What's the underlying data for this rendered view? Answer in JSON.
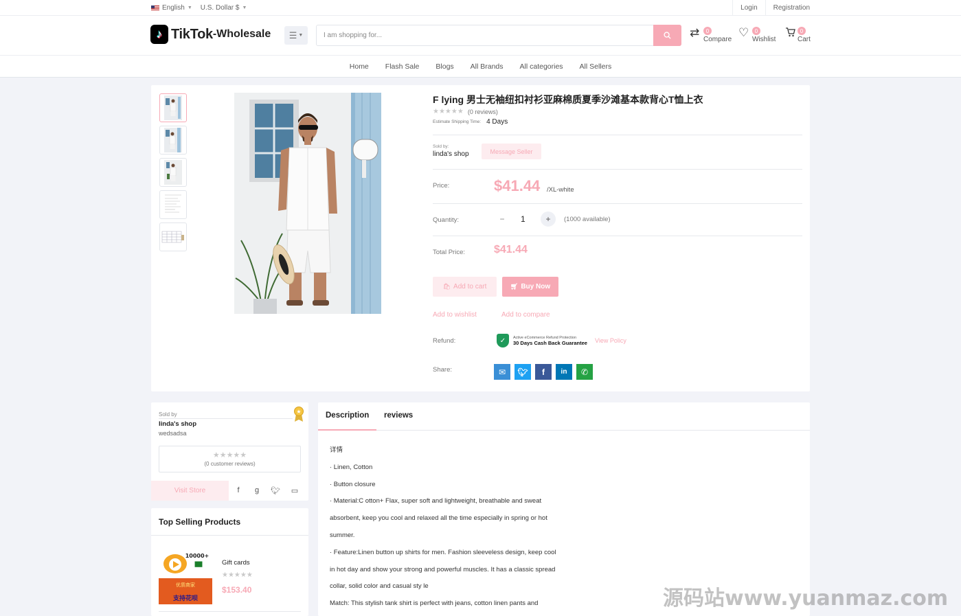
{
  "topbar": {
    "language": "English",
    "currency": "U.S. Dollar $",
    "login": "Login",
    "registration": "Registration"
  },
  "header": {
    "logo_main": "TikTok",
    "logo_sub": "-Wholesale",
    "search_placeholder": "I am shopping for...",
    "compare": {
      "label": "Compare",
      "count": "0"
    },
    "wishlist": {
      "label": "Wishlist",
      "count": "0"
    },
    "cart": {
      "label": "Cart",
      "count": "0"
    }
  },
  "nav": [
    "Home",
    "Flash Sale",
    "Blogs",
    "All Brands",
    "All categories",
    "All Sellers"
  ],
  "product": {
    "title": "F lying 男士无袖纽扣衬衫亚麻棉质夏季沙滩基本款背心T恤上衣",
    "stars": "★★★★★",
    "reviews": "(0 reviews)",
    "ship_label": "Estimate Shipping Time:",
    "ship_value": "4 Days",
    "sold_by_label": "Sold by:",
    "shop_name": "linda's shop",
    "message_seller": "Message Seller",
    "price_label": "Price:",
    "price": "$41.44",
    "variant": "/XL-white",
    "quantity_label": "Quantity:",
    "quantity": "1",
    "available": "(1000 available)",
    "total_label": "Total Price:",
    "total": "$41.44",
    "add_to_cart": "Add to cart",
    "buy_now": "Buy Now",
    "add_to_wishlist": "Add to wishlist",
    "add_to_compare": "Add to compare",
    "refund_label": "Refund:",
    "refund_small": "Active eCommerce Refund Protection",
    "refund_big": "30 Days Cash Back Guarantee",
    "view_policy": "View Policy",
    "share_label": "Share:"
  },
  "seller_card": {
    "sold_by": "Sold by",
    "name": "linda's shop",
    "subtitle": "wedsadsa",
    "stars": "★★★★★",
    "customer_reviews": "(0 customer reviews)",
    "visit_store": "Visit Store"
  },
  "top_selling": {
    "title": "Top Selling Products",
    "items": [
      {
        "name": "Gift cards",
        "stars": "★★★★★",
        "price": "$153.40",
        "img_text_1": "10000+",
        "img_text_2": "优质商家",
        "img_text_3": "支持花呗"
      }
    ]
  },
  "description": {
    "tabs": [
      "Description",
      "reviews"
    ],
    "lines": [
      "详情",
      "· Linen, Cotton",
      "· Button closure",
      "· Material:C otton+ Flax, super soft and lightweight, breathable and sweat",
      "absorbent, keep you cool and relaxed all the time especially in spring or hot",
      "summer.",
      "·  Feature:Linen button up shirts for men. Fashion sleeveless design, keep cool",
      "in hot day and show your strong and powerful muscles. It has a classic spread",
      "collar, solid color and casual sty le",
      "Match: This stylish tank shirt is perfect with jeans, cotton linen pants and"
    ]
  },
  "watermark": "源码站www.yuanmaz.com",
  "colors": {
    "accent": "#f7a9b5",
    "accent_light": "#fdecef",
    "background": "#f2f3f8"
  }
}
